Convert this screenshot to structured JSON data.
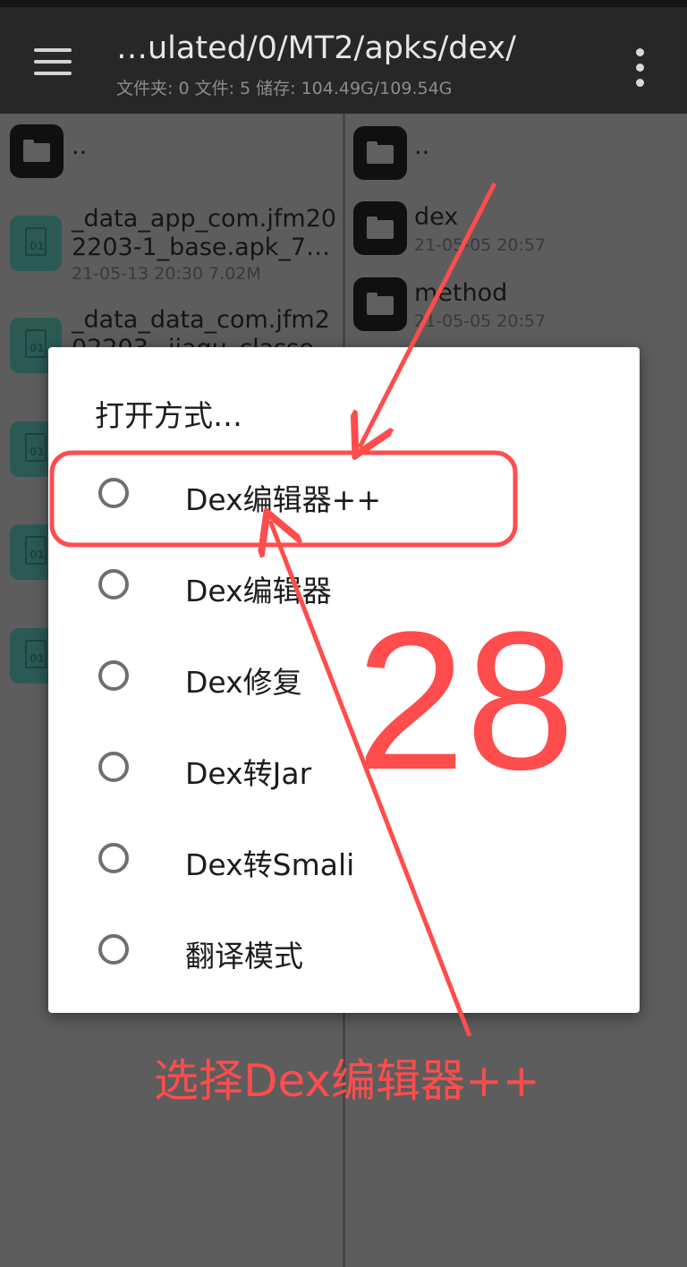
{
  "appbar": {
    "path": "…ulated/0/MT2/apks/dex/",
    "stats": "文件夹: 0  文件: 5  储存: 104.49G/109.54G"
  },
  "left_pane": {
    "parent": "..",
    "files": [
      {
        "name_line1": "_data_app_com.jfm20",
        "name_line2": "2203-1_base.apk_7…",
        "meta": "21-05-13 20:30  7.02M"
      },
      {
        "name_line1": "_data_data_com.jfm2",
        "name_line2": "02203_.jiagu_classe",
        "meta": ""
      }
    ],
    "file_icon_text": "01"
  },
  "right_pane": {
    "parent": "..",
    "folders": [
      {
        "name": "dex",
        "meta": "21-05-05 20:57"
      },
      {
        "name": "method",
        "meta": "21-05-05 20:57"
      }
    ]
  },
  "dialog": {
    "title": "打开方式…",
    "options": [
      "Dex编辑器++",
      "Dex编辑器",
      "Dex修复",
      "Dex转Jar",
      "Dex转Smali",
      "翻译模式"
    ]
  },
  "annotation": {
    "number": "28",
    "caption": "选择Dex编辑器++",
    "color": "#ff4c4c"
  }
}
